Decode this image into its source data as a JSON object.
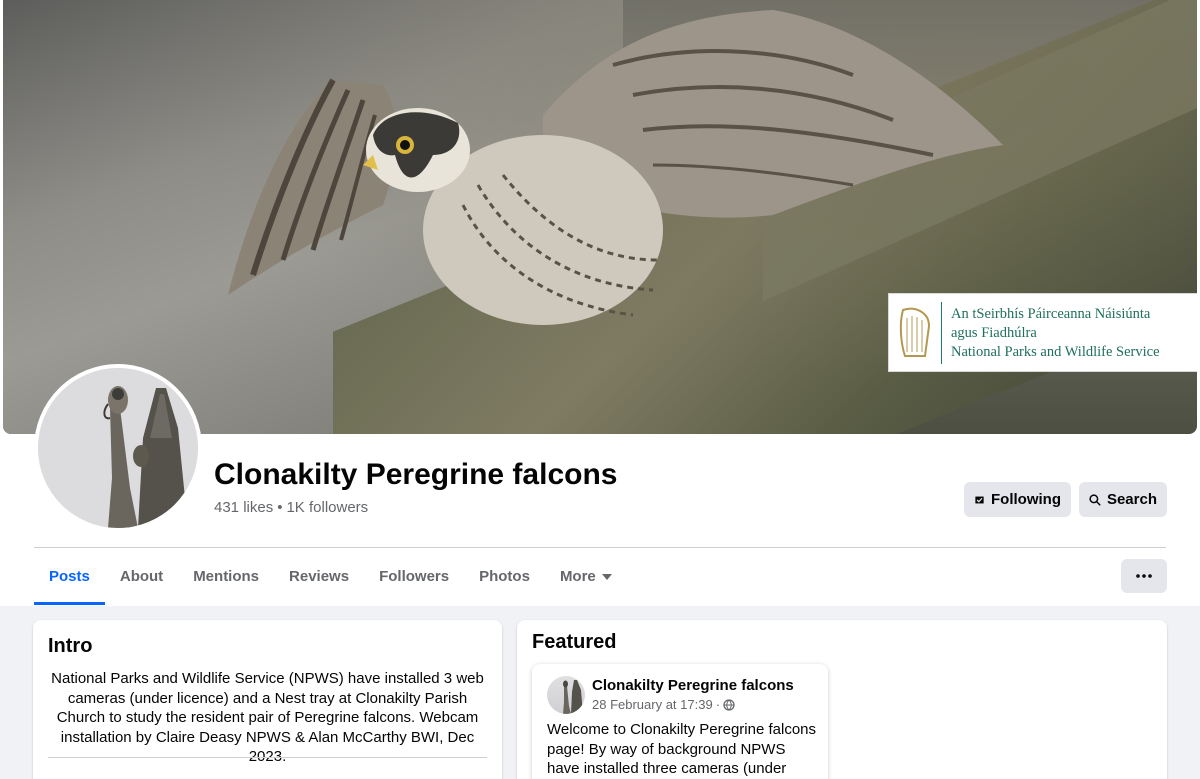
{
  "cover": {
    "badge_line1": "An tSeirbhís Páirceanna Náisiúnta",
    "badge_line2": "agus Fiadhúlra",
    "badge_line3": "National Parks and Wildlife Service"
  },
  "page": {
    "name": "Clonakilty Peregrine falcons",
    "likes": "431 likes",
    "separator": "•",
    "followers": "1K followers"
  },
  "actions": {
    "following_label": "Following",
    "search_label": "Search",
    "following_icon": "message-check-icon",
    "search_icon": "search-icon",
    "more_icon": "ellipsis-icon"
  },
  "tabs": [
    {
      "label": "Posts",
      "active": true
    },
    {
      "label": "About"
    },
    {
      "label": "Mentions"
    },
    {
      "label": "Reviews"
    },
    {
      "label": "Followers"
    },
    {
      "label": "Photos"
    },
    {
      "label": "More"
    }
  ],
  "intro": {
    "title": "Intro",
    "text": "National Parks and Wildlife Service (NPWS) have installed 3 web cameras (under licence) and a Nest tray at Clonakilty Parish Church to study the resident pair of Peregrine falcons. Webcam installation by Claire Deasy NPWS & Alan McCarthy BWI, Dec 2023."
  },
  "featured": {
    "title": "Featured",
    "post": {
      "author": "Clonakilty Peregrine falcons",
      "date": "28 February at 17:39",
      "dot": "·",
      "audience_icon": "globe-icon",
      "text": "Welcome to Clonakilty Peregrine falcons page! By way of background NPWS have installed three cameras (under licence)..."
    }
  },
  "colors": {
    "accent": "#0866ff",
    "secondary_text": "#65676b",
    "button_bg": "#e4e6eb",
    "page_bg": "#f0f2f5"
  }
}
